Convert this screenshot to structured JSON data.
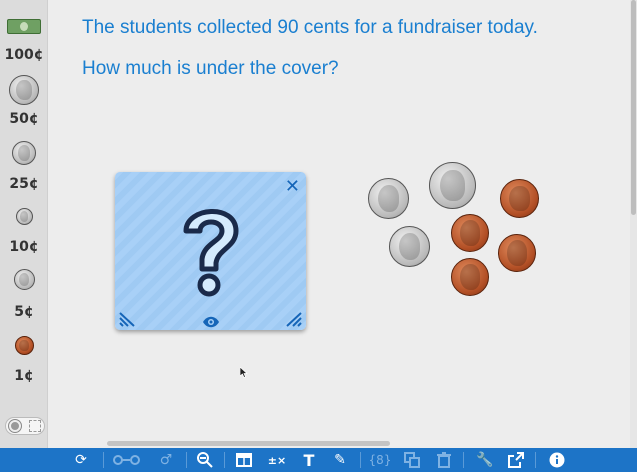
{
  "palette": {
    "items": [
      {
        "label": "100¢",
        "kind": "bill"
      },
      {
        "label": "50¢",
        "kind": "half-dollar"
      },
      {
        "label": "25¢",
        "kind": "quarter"
      },
      {
        "label": "10¢",
        "kind": "dime"
      },
      {
        "label": "5¢",
        "kind": "nickel"
      },
      {
        "label": "1¢",
        "kind": "penny"
      }
    ]
  },
  "main": {
    "line1": "The students collected 90 cents for a fundraiser today.",
    "line2": "How much is under the cover?"
  },
  "cover": {
    "close_glyph": "✕",
    "question_glyph": "?",
    "eye_glyph": "👁"
  },
  "workspace_coins": [
    {
      "kind": "nickel"
    },
    {
      "kind": "quarter"
    },
    {
      "kind": "penny"
    },
    {
      "kind": "nickel"
    },
    {
      "kind": "penny"
    },
    {
      "kind": "penny"
    },
    {
      "kind": "penny"
    }
  ],
  "toolbar": {
    "buttons": [
      "reset-icon",
      "number-line-icon",
      "gender-icon",
      "zoom-out-icon",
      "table-icon",
      "arithmetic-icon",
      "text-icon",
      "pencil-icon",
      "braces-icon",
      "duplicate-icon",
      "trash-icon",
      "wrench-icon",
      "share-icon",
      "info-icon"
    ]
  },
  "colors": {
    "accent": "#1a7fd0",
    "toolbar": "#1d74c7",
    "cover": "#a8d0f7",
    "penny": "#b24f25",
    "silver": "#b8b8b8"
  }
}
